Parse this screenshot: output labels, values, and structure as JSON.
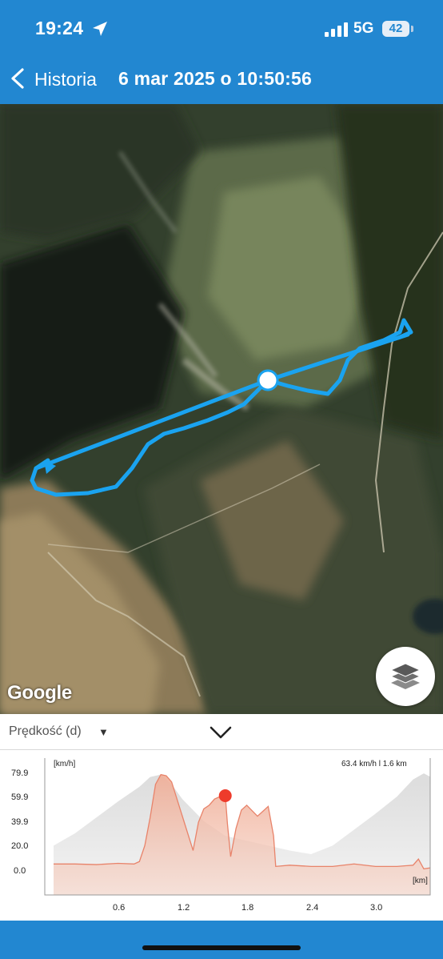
{
  "status_bar": {
    "time": "19:24",
    "network": "5G",
    "battery": "42",
    "location_icon": "location-arrow-icon",
    "signal_icon": "cellular-signal-icon"
  },
  "header": {
    "back_label": "Historia",
    "title": "6 mar 2025 o 10:50:56",
    "back_icon": "chevron-left-icon"
  },
  "map": {
    "attribution": "Google",
    "layers_icon": "layers-icon",
    "route_color": "#1aa3f0"
  },
  "chart_panel": {
    "metric_label": "Prędkość (d)",
    "metric_caret": "▼",
    "collapse_icon": "chevron-down-icon"
  },
  "chart_data": {
    "type": "area",
    "y_unit": "[km/h]",
    "x_unit": "[km]",
    "readout": "63.4  km/h l 1.6  km",
    "y_ticks": [
      "79.9",
      "59.9",
      "39.9",
      "20.0",
      "0.0"
    ],
    "x_ticks": [
      "0.6",
      "1.2",
      "1.8",
      "2.4",
      "3.0"
    ],
    "xlim": [
      0,
      3.6
    ],
    "ylim": [
      0,
      85
    ],
    "grid": false,
    "colors": {
      "speed": "#e8836a",
      "elevation": "#d2d2d2",
      "marker": "#ee3b2b"
    },
    "marker": {
      "x": 1.6,
      "y": 63.4
    },
    "series": [
      {
        "role": "speed",
        "x": [
          0,
          0.2,
          0.4,
          0.6,
          0.75,
          0.8,
          0.85,
          0.9,
          0.95,
          1.0,
          1.05,
          1.1,
          1.2,
          1.3,
          1.35,
          1.4,
          1.45,
          1.5,
          1.55,
          1.6,
          1.62,
          1.65,
          1.7,
          1.75,
          1.8,
          1.9,
          2.0,
          2.05,
          2.07,
          2.2,
          2.4,
          2.6,
          2.8,
          3.0,
          3.2,
          3.35,
          3.4,
          3.45,
          3.6
        ],
        "y": [
          7,
          7,
          6.5,
          7.5,
          7,
          9,
          22,
          45,
          72,
          80,
          79,
          74,
          46,
          18,
          41,
          52,
          55,
          60,
          62,
          63.4,
          40,
          13,
          36,
          51,
          55,
          46,
          54,
          30,
          5,
          6,
          5,
          5,
          7,
          5,
          5,
          6,
          11,
          3,
          5
        ]
      },
      {
        "role": "elevation",
        "x": [
          0,
          0.2,
          0.4,
          0.6,
          0.8,
          0.9,
          1.0,
          1.1,
          1.2,
          1.4,
          1.6,
          1.8,
          2.0,
          2.2,
          2.4,
          2.6,
          2.8,
          3.0,
          3.2,
          3.35,
          3.45,
          3.6
        ],
        "y": [
          22,
          32,
          45,
          58,
          70,
          78,
          80,
          72,
          60,
          42,
          30,
          26,
          22,
          18,
          15,
          22,
          35,
          48,
          62,
          76,
          81,
          74
        ]
      }
    ]
  }
}
